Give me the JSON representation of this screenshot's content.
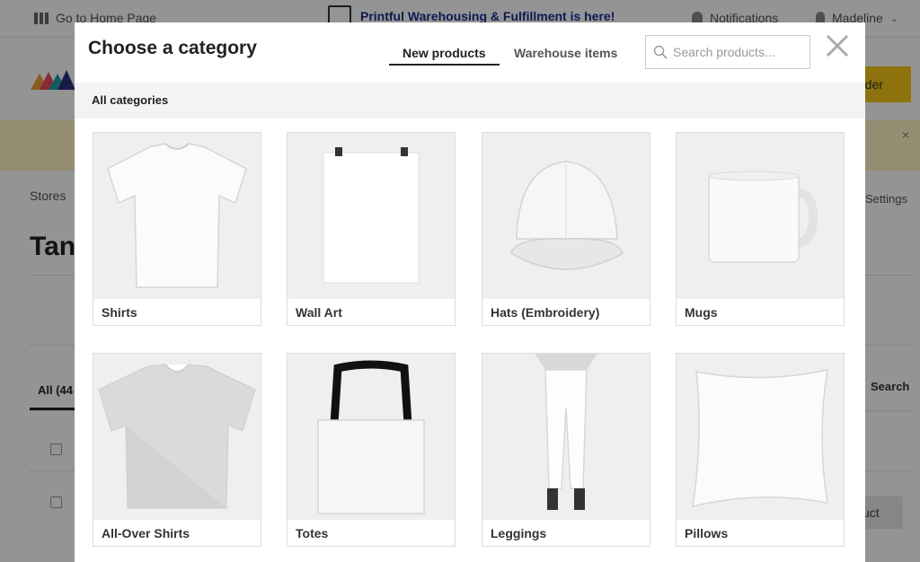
{
  "background": {
    "topbar": {
      "home_link": "Go to Home Page",
      "promo": "Printful Warehousing & Fulfillment is here!",
      "notifications": "Notifications",
      "user_name": "Madeline"
    },
    "order_button": "rder",
    "banner_close": "×",
    "breadcrumb": "Stores",
    "settings_link": "Settings",
    "store_title": "Tan",
    "all_tab": "All (44",
    "search_label": "Search",
    "product_button": "uct"
  },
  "modal": {
    "title": "Choose a category",
    "tabs": [
      {
        "label": "New products",
        "active": true
      },
      {
        "label": "Warehouse items",
        "active": false
      }
    ],
    "search": {
      "placeholder": "Search products...",
      "value": ""
    },
    "subheader": "All categories",
    "categories": [
      {
        "label": "Shirts",
        "icon": "t-shirt-image"
      },
      {
        "label": "Wall Art",
        "icon": "poster-image"
      },
      {
        "label": "Hats (Embroidery)",
        "icon": "hat-image"
      },
      {
        "label": "Mugs",
        "icon": "mug-image"
      },
      {
        "label": "All-Over Shirts",
        "icon": "all-over-shirt-image"
      },
      {
        "label": "Totes",
        "icon": "tote-bag-image"
      },
      {
        "label": "Leggings",
        "icon": "leggings-image"
      },
      {
        "label": "Pillows",
        "icon": "pillow-image"
      }
    ]
  },
  "colors": {
    "accent": "#222222",
    "promo_link": "#1a2c8f",
    "order_button": "#f5c518",
    "banner": "#fff3c4"
  }
}
